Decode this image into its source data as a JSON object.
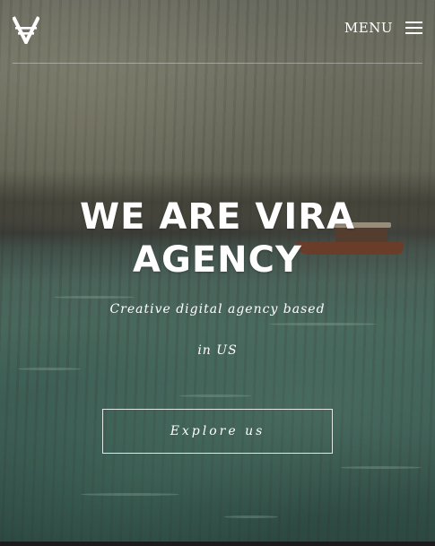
{
  "header": {
    "logo_icon": "vira-logo-icon",
    "menu_label": "MENU",
    "menu_icon": "hamburger-icon"
  },
  "hero": {
    "title_line1": "WE ARE VIRA",
    "title_line2": "AGENCY",
    "subtitle_line1": "Creative digital agency based",
    "subtitle_line2": "in US",
    "cta_label": "Explore us"
  },
  "colors": {
    "text": "#ffffff",
    "cliff": "#8b8a7c",
    "sea": "#5c8576",
    "boat_hull": "#8a4a30"
  }
}
